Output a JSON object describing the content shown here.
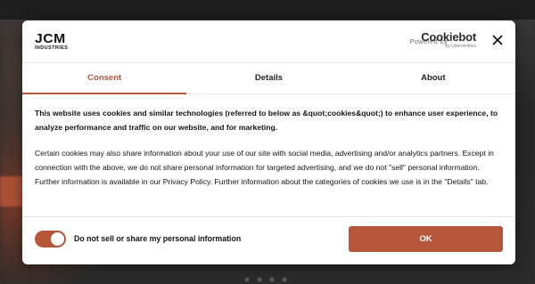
{
  "header": {
    "logo_main": "JCM",
    "logo_sub": "INDUSTRIES",
    "powered_by": "Powered by",
    "cookiebot_name": "Cookiebot",
    "cookiebot_sub": "by Usercentrics",
    "close_icon": "close-icon"
  },
  "tabs": [
    {
      "label": "Consent",
      "active": true
    },
    {
      "label": "Details",
      "active": false
    },
    {
      "label": "About",
      "active": false
    }
  ],
  "body": {
    "lead": "This website uses cookies and similar technologies (referred to below as &quot;cookies&quot;) to enhance user experience, to analyze performance and traffic on our website, and for marketing.",
    "paragraph": "Certain cookies may also share information about your use of our site with social media, advertising and/or analytics partners. Except in connection with the above, we do not share personal information for targeted advertising, and we do not \"sell\" personal information. Further information is available in our Privacy Policy. Further information about the categories of cookies we use is in the \"Details\" tab."
  },
  "footer": {
    "toggle_label": "Do not sell or share my personal information",
    "toggle_on": true,
    "ok_label": "OK"
  },
  "colors": {
    "accent": "#b5553a",
    "text": "#141414"
  }
}
